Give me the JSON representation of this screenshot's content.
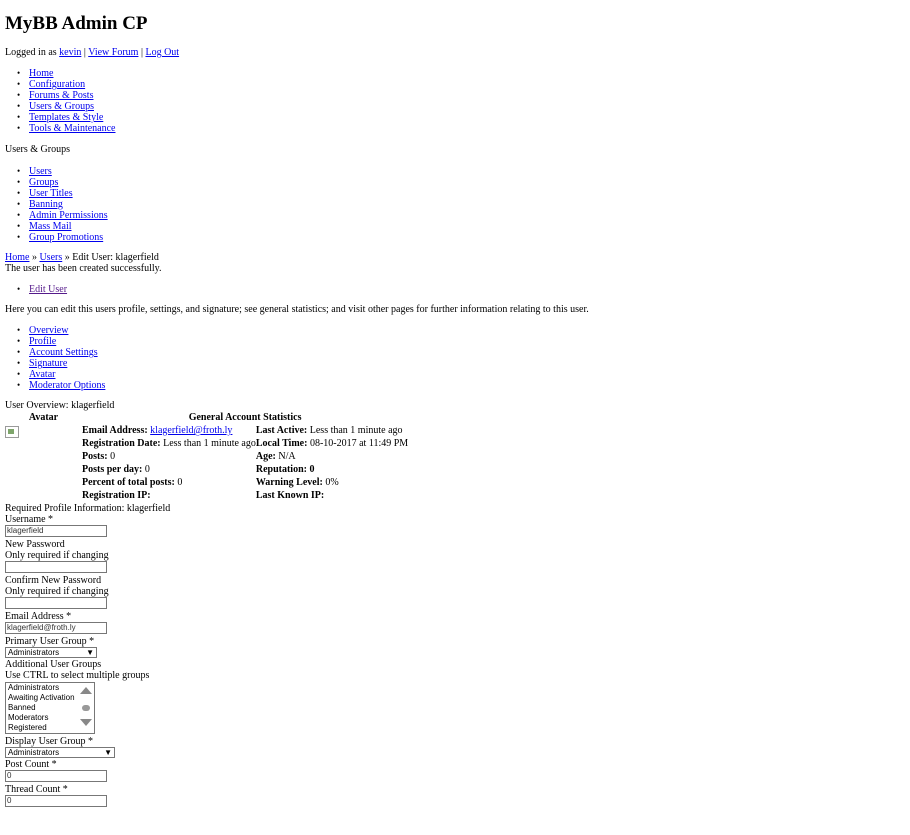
{
  "header": {
    "title": "MyBB Admin CP",
    "logged_prefix": "Logged in as",
    "username": "kevin",
    "sep1": "|",
    "view_forum": "View Forum",
    "sep2": "|",
    "log_out": "Log Out"
  },
  "main_menu": [
    "Home",
    "Configuration",
    "Forums & Posts",
    "Users & Groups",
    "Templates & Style",
    "Tools & Maintenance"
  ],
  "section": {
    "title": "Users & Groups",
    "items": [
      "Users",
      "Groups",
      "User Titles",
      "Banning",
      "Admin Permissions",
      "Mass Mail",
      "Group Promotions"
    ]
  },
  "breadcrumb": {
    "home": "Home",
    "sep1": "»",
    "users": "Users",
    "sep2": "»",
    "current": "Edit User: klagerfield"
  },
  "flash": "The user has been created successfully.",
  "edit_menu": [
    "Edit User"
  ],
  "description": "Here you can edit this users profile, settings, and signature; see general statistics; and visit other pages for further information relating to this user.",
  "tabs": [
    "Overview",
    "Profile",
    "Account Settings",
    "Signature",
    "Avatar",
    "Moderator Options"
  ],
  "overview": {
    "title": "User Overview: klagerfield",
    "col_avatar": "Avatar",
    "col_stats": "General Account Statistics",
    "email_label": "Email Address:",
    "email_value": "klagerfield@froth.ly",
    "last_active_label": "Last Active:",
    "last_active_value": "Less than 1 minute ago",
    "reg_date_label": "Registration Date:",
    "reg_date_value": "Less than 1 minute ago",
    "local_time_label": "Local Time:",
    "local_time_value": "08-10-2017 at 11:49 PM",
    "posts_label": "Posts:",
    "posts_value": "0",
    "age_label": "Age:",
    "age_value": "N/A",
    "ppd_label": "Posts per day:",
    "ppd_value": "0",
    "rep_label": "Reputation:",
    "rep_value": "0",
    "pct_label": "Percent of total posts:",
    "pct_value": "0",
    "warn_label": "Warning Level:",
    "warn_value": "0%",
    "reg_ip_label": "Registration IP:",
    "last_ip_label": "Last Known IP:"
  },
  "profile": {
    "title": "Required Profile Information: klagerfield",
    "username_label": "Username *",
    "username_value": "klagerfield",
    "new_password_label": "New Password",
    "new_password_desc": "Only required if changing",
    "confirm_password_label": "Confirm New Password",
    "confirm_password_desc": "Only required if changing",
    "email_label": "Email Address *",
    "email_value": "klagerfield@froth.ly",
    "primary_group_label": "Primary User Group *",
    "primary_group_value": "Administrators",
    "additional_groups_label": "Additional User Groups",
    "additional_groups_desc": "Use CTRL to select multiple groups",
    "additional_groups_options": [
      "Administrators",
      "Awaiting Activation",
      "Banned",
      "Moderators",
      "Registered"
    ],
    "display_group_label": "Display User Group *",
    "display_group_value": "Administrators",
    "post_count_label": "Post Count *",
    "post_count_value": "0",
    "thread_count_label": "Thread Count *",
    "thread_count_value": "0"
  }
}
